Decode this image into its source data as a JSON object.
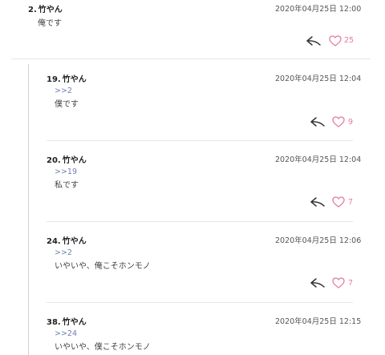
{
  "comments": [
    {
      "number": "2.",
      "name": "竹やん",
      "date": "2020年04月25日 12:00",
      "anchor": "",
      "text": "俺です",
      "likes": "25"
    },
    {
      "number": "19.",
      "name": "竹やん",
      "date": "2020年04月25日 12:04",
      "anchor": ">>2",
      "text": "僕です",
      "likes": "9"
    },
    {
      "number": "20.",
      "name": "竹やん",
      "date": "2020年04月25日 12:04",
      "anchor": ">>19",
      "text": "私です",
      "likes": "7"
    },
    {
      "number": "24.",
      "name": "竹やん",
      "date": "2020年04月25日 12:06",
      "anchor": ">>2",
      "text": "いやいや、俺こそホンモノ",
      "likes": "7"
    },
    {
      "number": "38.",
      "name": "竹やん",
      "date": "2020年04月25日 12:15",
      "anchor": ">>24",
      "text": "いやいや、僕こそホンモノ",
      "likes": ""
    }
  ],
  "icons": {
    "reply": "reply-arrow-icon",
    "like": "heart-icon"
  },
  "colors": {
    "like": "#e57aa0",
    "anchor": "#6b7fb0",
    "divider": "#e6e6e6"
  }
}
